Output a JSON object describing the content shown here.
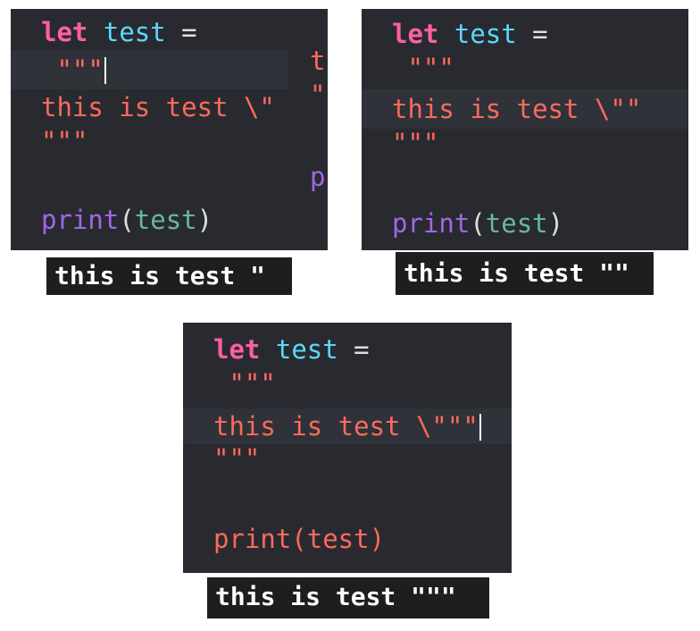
{
  "panels": [
    {
      "lines": [
        {
          "tokens": [
            {
              "t": "let",
              "c": "kw"
            },
            {
              "t": " ",
              "c": "plain"
            },
            {
              "t": "test",
              "c": "ident"
            },
            {
              "t": " =",
              "c": "plain"
            }
          ]
        },
        {
          "tokens": [
            {
              "t": " \"\"\"",
              "c": "str"
            }
          ],
          "cursor": true,
          "highlight": true
        },
        {
          "tokens": [
            {
              "t": "this is test \\\"",
              "c": "str"
            }
          ]
        },
        {
          "tokens": [
            {
              "t": "\"\"\"",
              "c": "str"
            }
          ]
        },
        {
          "tokens": []
        },
        {
          "tokens": [
            {
              "t": "print",
              "c": "fn"
            },
            {
              "t": "(",
              "c": "punct"
            },
            {
              "t": "test",
              "c": "arg"
            },
            {
              "t": ")",
              "c": "punct"
            }
          ]
        }
      ],
      "output": "this is test \""
    },
    {
      "lines": [
        {
          "tokens": [
            {
              "t": "let",
              "c": "kw"
            },
            {
              "t": " ",
              "c": "plain"
            },
            {
              "t": "test",
              "c": "ident"
            },
            {
              "t": " =",
              "c": "plain"
            }
          ]
        },
        {
          "tokens": [
            {
              "t": " \"\"\"",
              "c": "str"
            }
          ]
        },
        {
          "tokens": [
            {
              "t": "this is test \\\"\"",
              "c": "str"
            }
          ],
          "highlight": true
        },
        {
          "tokens": [
            {
              "t": "\"\"\"",
              "c": "str"
            }
          ]
        },
        {
          "tokens": []
        },
        {
          "tokens": [
            {
              "t": "print",
              "c": "fn"
            },
            {
              "t": "(",
              "c": "punct"
            },
            {
              "t": "test",
              "c": "arg"
            },
            {
              "t": ")",
              "c": "punct"
            }
          ]
        }
      ],
      "output": "this is test \"\""
    },
    {
      "lines": [
        {
          "tokens": [
            {
              "t": "let",
              "c": "kw"
            },
            {
              "t": " ",
              "c": "plain"
            },
            {
              "t": "test",
              "c": "ident"
            },
            {
              "t": " =",
              "c": "plain"
            }
          ]
        },
        {
          "tokens": [
            {
              "t": " \"\"\"",
              "c": "str"
            }
          ]
        },
        {
          "tokens": [
            {
              "t": "this is test \\\"\"\"",
              "c": "str"
            }
          ],
          "cursor": true,
          "highlight": true
        },
        {
          "tokens": [
            {
              "t": "\"\"\"",
              "c": "str"
            }
          ]
        },
        {
          "tokens": []
        },
        {
          "tokens": [
            {
              "t": "print(test)",
              "c": "str"
            }
          ]
        }
      ],
      "output": "this is test \"\"\""
    }
  ],
  "overlap": {
    "chars": [
      "t",
      "\"",
      "p"
    ],
    "colors": [
      "#fc6a5d",
      "#fc6a5d",
      "#a167e6"
    ]
  }
}
